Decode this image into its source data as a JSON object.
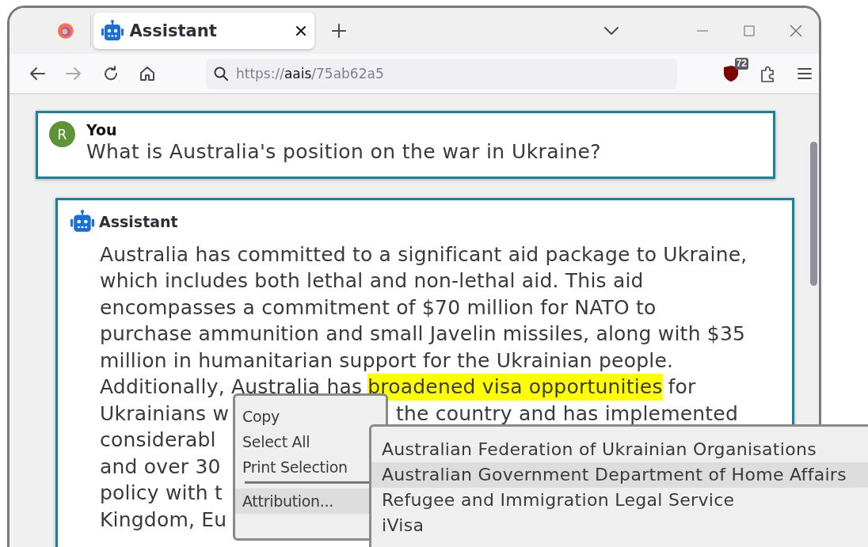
{
  "tabs": [
    {
      "label": "Assistant",
      "selected": true
    }
  ],
  "address_bar": {
    "scheme": "https://",
    "host": "aais",
    "path": "/75ab62a5"
  },
  "extension_badge": "72",
  "conversation": [
    {
      "kind": "user",
      "avatar": "R",
      "author": "You",
      "lines": [
        {
          "text": "What is Australia's position on the war in Ukraine?"
        }
      ]
    },
    {
      "kind": "assistant",
      "author": "Assistant",
      "lines": [
        {
          "segments": [
            {
              "text": "Australia has committed to a significant aid package to Ukraine,",
              "highlighted": false
            }
          ]
        },
        {
          "segments": [
            {
              "text": "which includes both lethal and non-lethal aid. This aid",
              "highlighted": false
            }
          ]
        },
        {
          "segments": [
            {
              "text": "encompasses a commitment of $70 million for NATO to",
              "highlighted": false
            }
          ]
        },
        {
          "segments": [
            {
              "text": "purchase ammunition and small Javelin missiles, along with $35",
              "highlighted": false
            }
          ]
        },
        {
          "segments": [
            {
              "text": "million in humanitarian support for the Ukrainian people.",
              "highlighted": false
            }
          ]
        },
        {
          "segments": [
            {
              "text": "Additionally, Australia has",
              "highlighted": false
            },
            {
              "text": "broadened visa opportunities",
              "highlighted": true
            },
            {
              "text": "for",
              "highlighted": false
            }
          ]
        },
        {
          "segments": [
            {
              "text": "Ukrainians w",
              "highlighted": false
            }
          ],
          "after_menu": "the country and has implemented"
        },
        {
          "segments": [
            {
              "text": "considerabl",
              "highlighted": false
            }
          ]
        },
        {
          "segments": [
            {
              "text": "and over 30",
              "highlighted": false
            }
          ]
        },
        {
          "segments": [
            {
              "text": "policy with t",
              "highlighted": false
            }
          ]
        },
        {
          "segments": [
            {
              "text": "Kingdom, Eu",
              "highlighted": false
            }
          ]
        }
      ]
    }
  ],
  "context_menu": {
    "items": [
      {
        "kind": "item",
        "label": "Copy",
        "selected": false
      },
      {
        "kind": "item",
        "label": "Select All",
        "selected": false
      },
      {
        "kind": "item",
        "label": "Print Selection",
        "selected": false
      },
      {
        "kind": "separator"
      },
      {
        "kind": "item",
        "label": "Attribution...",
        "selected": true
      }
    ]
  },
  "submenu": {
    "items": [
      {
        "label": "Australian Federation of Ukrainian Organisations",
        "selected": false
      },
      {
        "label": "Australian Government Department of Home Affairs",
        "selected": true
      },
      {
        "label": "Refugee and Immigration Legal Service",
        "selected": false
      },
      {
        "label": "iVisa",
        "selected": false
      }
    ]
  }
}
